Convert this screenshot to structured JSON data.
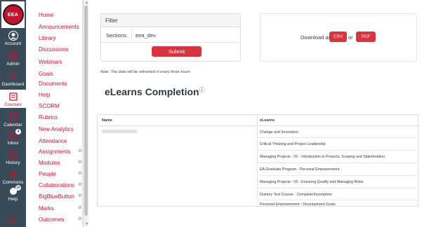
{
  "global_nav": {
    "logo_text": "EEA",
    "items": [
      {
        "label": "Account",
        "icon": "account-icon"
      },
      {
        "label": "Admin",
        "icon": "admin-icon"
      },
      {
        "label": "Dashboard",
        "icon": "dashboard-icon"
      },
      {
        "label": "Courses",
        "icon": "courses-icon"
      },
      {
        "label": "Calendar",
        "icon": "calendar-icon"
      },
      {
        "label": "Inbox",
        "icon": "inbox-icon",
        "badge": "4"
      },
      {
        "label": "History",
        "icon": "history-icon"
      },
      {
        "label": "Commons",
        "icon": "commons-icon"
      },
      {
        "label": "Help",
        "icon": "help-icon",
        "badge": "10"
      }
    ]
  },
  "course_nav": {
    "items": [
      "Home",
      "Announcements",
      "Library",
      "Discussions",
      "Webinars",
      "Goals",
      "Documents",
      "Help",
      "SCORM",
      "Rubrics",
      "New Analytics",
      "Attendance",
      "Assignments",
      "Modules",
      "People",
      "Collaborations",
      "BigBlueButton",
      "Marks",
      "Outcomes"
    ]
  },
  "filter": {
    "header": "Filter",
    "sections_label": "Sections:",
    "sections_value": "eea_dev",
    "submit_label": "Submit"
  },
  "download": {
    "label": "Download as",
    "csv_label": "CSV",
    "or_label": "or",
    "pdf_label": "PDF"
  },
  "note": "Note: The data will be refreshed in every three hours",
  "title": "eLearns Completion",
  "title_sup": "ⓘ",
  "table": {
    "col_name": "Name",
    "col_elearns": "eLearns",
    "elearns": [
      "Change and Innovation",
      "Critical Thinking and Project Leadership",
      "Managing Projects - 01 - Introduction to Projects, Scoping and Stakeholders",
      "EA Graduate Program - Personal Empowerment",
      "Managing Projects - 02 - Ensuring Quality and Managing Risks",
      "Dummy Test Course - Complete/Incomplete",
      "Personal Empowerment - Development Goals"
    ]
  },
  "colors": {
    "accent": "#c8102e",
    "button": "#d6343e",
    "nav": "#394b58"
  }
}
